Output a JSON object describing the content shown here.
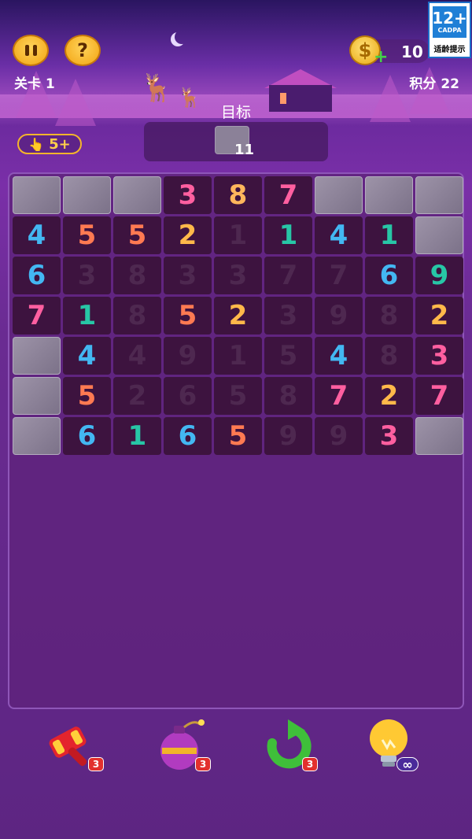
{
  "header": {
    "level_text": "关卡 1",
    "score_text": "积分 22",
    "coins": "10",
    "coin_symbol": "$",
    "coin_plus": "+",
    "pause_icon": "pause-icon",
    "help_label": "?",
    "age_rating": "12+",
    "age_org": "CADPA",
    "age_hint": "适龄提示"
  },
  "target": {
    "label": "目标",
    "count": "11"
  },
  "hint": {
    "label": "5+"
  },
  "board": {
    "rows": [
      [
        {
          "t": "b"
        },
        {
          "t": "b"
        },
        {
          "t": "b"
        },
        {
          "v": "3",
          "c": "#ff5fa0"
        },
        {
          "v": "8",
          "c": "#ffb65c"
        },
        {
          "v": "7",
          "c": "#ff5fa0"
        },
        {
          "t": "b"
        },
        {
          "t": "b"
        },
        {
          "t": "b"
        }
      ],
      [
        {
          "v": "4",
          "c": "#43b7f2"
        },
        {
          "v": "5",
          "c": "#ff7a52"
        },
        {
          "v": "5",
          "c": "#ff7a52"
        },
        {
          "v": "2",
          "c": "#ffb84a"
        },
        {
          "v": "1",
          "d": 1
        },
        {
          "v": "1",
          "c": "#27c6a6"
        },
        {
          "v": "4",
          "c": "#43b7f2"
        },
        {
          "v": "1",
          "c": "#27c6a6"
        },
        {
          "t": "b"
        }
      ],
      [
        {
          "v": "6",
          "c": "#43b7f2"
        },
        {
          "v": "3",
          "d": 1
        },
        {
          "v": "8",
          "d": 1
        },
        {
          "v": "3",
          "d": 1
        },
        {
          "v": "3",
          "d": 1
        },
        {
          "v": "7",
          "d": 1
        },
        {
          "v": "7",
          "d": 1
        },
        {
          "v": "6",
          "c": "#43b7f2"
        },
        {
          "v": "9",
          "c": "#27c6a6"
        }
      ],
      [
        {
          "v": "7",
          "c": "#ff5fa0"
        },
        {
          "v": "1",
          "c": "#27c6a6"
        },
        {
          "v": "8",
          "d": 1
        },
        {
          "v": "5",
          "c": "#ff7a52"
        },
        {
          "v": "2",
          "c": "#ffb84a"
        },
        {
          "v": "3",
          "d": 1
        },
        {
          "v": "9",
          "d": 1
        },
        {
          "v": "8",
          "d": 1
        },
        {
          "v": "2",
          "c": "#ffb84a"
        }
      ],
      [
        {
          "t": "b"
        },
        {
          "v": "4",
          "c": "#43b7f2"
        },
        {
          "v": "4",
          "d": 1
        },
        {
          "v": "9",
          "d": 1
        },
        {
          "v": "1",
          "d": 1
        },
        {
          "v": "5",
          "d": 1
        },
        {
          "v": "4",
          "c": "#43b7f2"
        },
        {
          "v": "8",
          "d": 1
        },
        {
          "v": "3",
          "c": "#ff5fa0"
        }
      ],
      [
        {
          "t": "b"
        },
        {
          "v": "5",
          "c": "#ff7a52"
        },
        {
          "v": "2",
          "d": 1
        },
        {
          "v": "6",
          "d": 1
        },
        {
          "v": "5",
          "d": 1
        },
        {
          "v": "8",
          "d": 1
        },
        {
          "v": "7",
          "c": "#ff5fa0"
        },
        {
          "v": "2",
          "c": "#ffb84a"
        },
        {
          "v": "7",
          "c": "#ff5fa0"
        }
      ],
      [
        {
          "t": "b"
        },
        {
          "v": "6",
          "c": "#43b7f2"
        },
        {
          "v": "1",
          "c": "#27c6a6"
        },
        {
          "v": "6",
          "c": "#43b7f2"
        },
        {
          "v": "5",
          "c": "#ff7a52"
        },
        {
          "v": "9",
          "d": 1
        },
        {
          "v": "9",
          "d": 1
        },
        {
          "v": "3",
          "c": "#ff5fa0"
        },
        {
          "t": "b"
        }
      ]
    ]
  },
  "tools": [
    {
      "name": "hammer-icon",
      "count": "3"
    },
    {
      "name": "bomb-icon",
      "count": "3"
    },
    {
      "name": "undo-arrow-icon",
      "count": "3"
    },
    {
      "name": "lightbulb-hint-icon",
      "count": "∞"
    }
  ],
  "colors": {
    "blue": "#43b7f2",
    "orange": "#ff7a52",
    "pink": "#ff5fa0",
    "yellow": "#ffb84a",
    "teal": "#27c6a6"
  }
}
